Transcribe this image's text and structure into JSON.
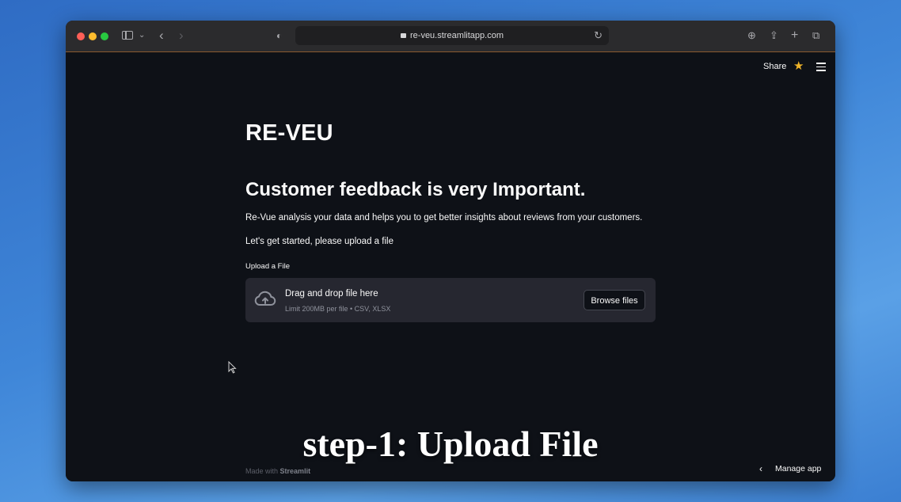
{
  "browser": {
    "url": "re-veu.streamlitapp.com"
  },
  "header": {
    "share_label": "Share"
  },
  "main": {
    "title": "RE-VEU",
    "subtitle": "Customer feedback is very Important.",
    "intro": "Re-Vue analysis your data and helps you to get better insights about reviews from your customers.",
    "prompt": "Let's get started, please upload a file",
    "uploader": {
      "label": "Upload a File",
      "drop_text": "Drag and drop file here",
      "limit_text": "Limit 200MB per file • CSV, XLSX",
      "browse_label": "Browse files"
    }
  },
  "overlay": {
    "caption": "step-1: Upload File"
  },
  "footer": {
    "made_with": "Made with",
    "brand": "Streamlit",
    "manage_label": "Manage app"
  },
  "colors": {
    "background": "#0e1117",
    "dropzone": "#262730",
    "star": "#f0b429",
    "text": "#fafafa"
  }
}
